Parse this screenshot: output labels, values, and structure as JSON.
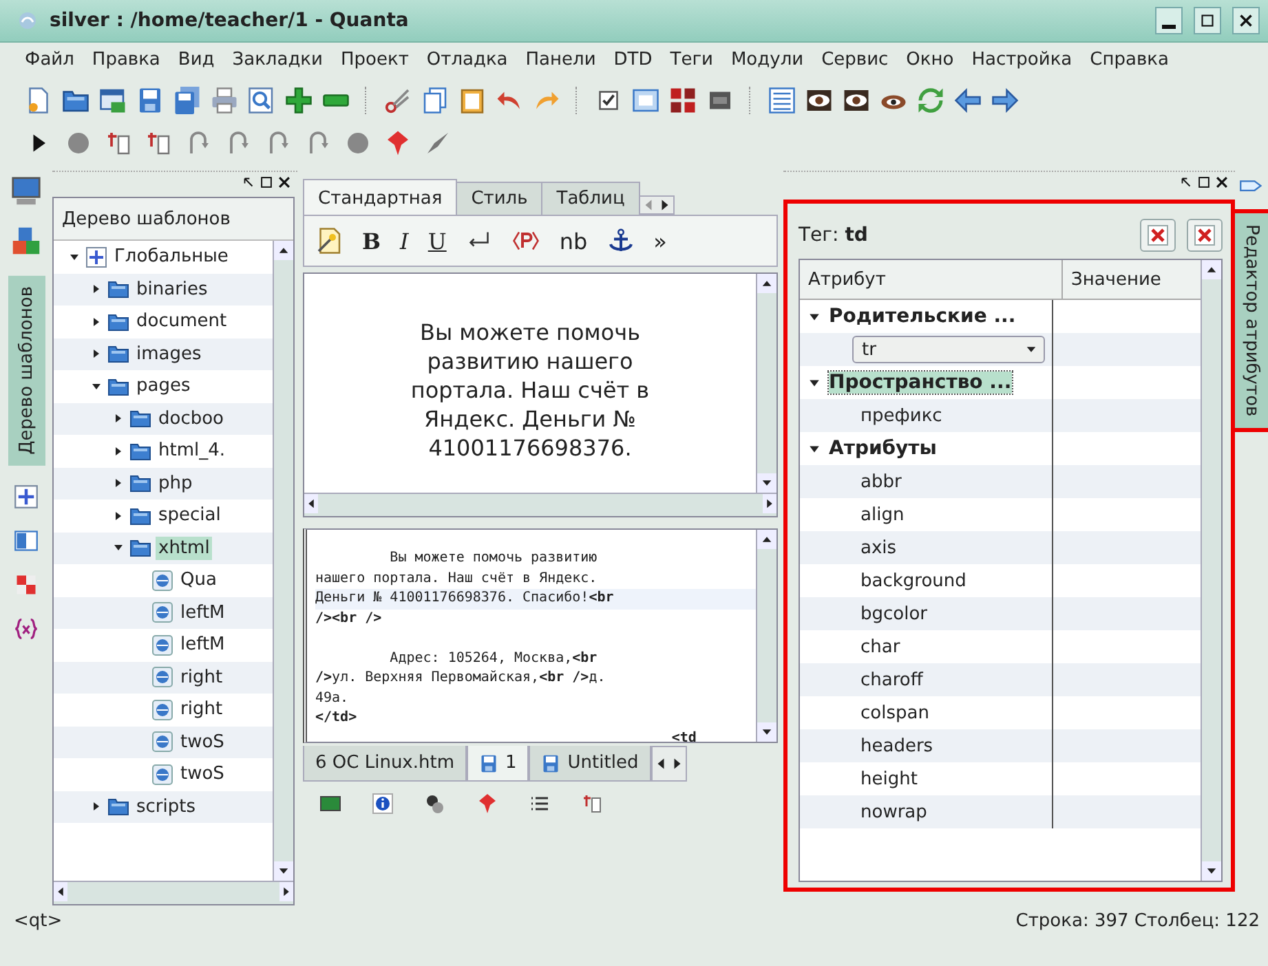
{
  "window": {
    "title": "silver : /home/teacher/1 - Quanta"
  },
  "menu": [
    {
      "label": "Файл"
    },
    {
      "label": "Правка"
    },
    {
      "label": "Вид"
    },
    {
      "label": "Закладки"
    },
    {
      "label": "Проект"
    },
    {
      "label": "Отладка"
    },
    {
      "label": "Панели"
    },
    {
      "label": "DTD"
    },
    {
      "label": "Теги"
    },
    {
      "label": "Модули"
    },
    {
      "label": "Сервис"
    },
    {
      "label": "Окно"
    },
    {
      "label": "Настройка"
    },
    {
      "label": "Справка"
    }
  ],
  "left_dock_tab": {
    "label": "Дерево шаблонов",
    "selected": true
  },
  "template_tree": {
    "title": "Дерево шаблонов",
    "items": [
      {
        "kind": "root",
        "label": "Глобальные",
        "expanded": true,
        "selected": false,
        "children": [
          {
            "kind": "folder",
            "label": "binaries",
            "expanded": false,
            "selected": false
          },
          {
            "kind": "folder",
            "label": "document",
            "expanded": false,
            "selected": false
          },
          {
            "kind": "folder",
            "label": "images",
            "expanded": false,
            "selected": false
          },
          {
            "kind": "folder",
            "label": "pages",
            "expanded": true,
            "selected": false,
            "children": [
              {
                "kind": "folder",
                "label": "docboo",
                "expanded": false,
                "selected": false
              },
              {
                "kind": "folder",
                "label": "html_4.",
                "expanded": false,
                "selected": false
              },
              {
                "kind": "folder",
                "label": "php",
                "expanded": false,
                "selected": false
              },
              {
                "kind": "folder",
                "label": "special",
                "expanded": false,
                "selected": false
              },
              {
                "kind": "folder",
                "label": "xhtml",
                "expanded": true,
                "selected": true,
                "children": [
                  {
                    "kind": "file",
                    "label": "Qua",
                    "selected": false
                  },
                  {
                    "kind": "file",
                    "label": "leftM",
                    "selected": false
                  },
                  {
                    "kind": "file",
                    "label": "leftM",
                    "selected": false
                  },
                  {
                    "kind": "file",
                    "label": "right",
                    "selected": false
                  },
                  {
                    "kind": "file",
                    "label": "right",
                    "selected": false
                  },
                  {
                    "kind": "file",
                    "label": "twoS",
                    "selected": false
                  },
                  {
                    "kind": "file",
                    "label": "twoS",
                    "selected": false
                  }
                ]
              }
            ]
          },
          {
            "kind": "folder",
            "label": "scripts",
            "expanded": false,
            "selected": false
          }
        ]
      }
    ]
  },
  "toolbox_tabs": [
    {
      "label": "Стандартная",
      "selected": true
    },
    {
      "label": "Стиль",
      "selected": false
    },
    {
      "label": "Таблиц",
      "selected": false
    }
  ],
  "quick_tags": [
    {
      "kind": "icon"
    },
    {
      "kind": "bold",
      "text": "B"
    },
    {
      "kind": "italic",
      "text": "I"
    },
    {
      "kind": "underline",
      "text": "U"
    },
    {
      "kind": "icon"
    },
    {
      "kind": "icon"
    },
    {
      "kind": "plain",
      "text": "nb"
    },
    {
      "kind": "icon"
    },
    {
      "kind": "plain",
      "text": "»"
    }
  ],
  "preview": {
    "text": "Вы можете помочь развитию нашего портала. Наш счёт в Яндекс. Деньги № 41001176698376."
  },
  "source_lines": [
    {
      "kind": "code",
      "text": "         Вы можете помочь развитию",
      "current": false
    },
    {
      "kind": "code",
      "text": "нашего портала. Наш счёт в Яндекс.",
      "current": false
    },
    {
      "kind": "code",
      "text": "Деньги № 41001176698376. Спасибо!**<br**",
      "current": true
    },
    {
      "kind": "code",
      "text": "**/><br />**",
      "current": false
    },
    {
      "kind": "blank"
    },
    {
      "kind": "code",
      "text": "         Адрес: 105264, Москва,**<br**",
      "current": false
    },
    {
      "kind": "code",
      "text": "**/>**ул. Верхняя Первомайская,**<br />**д.",
      "current": false
    },
    {
      "kind": "code",
      "text": "49а.",
      "current": false
    },
    {
      "kind": "code",
      "text": "**</td>**",
      "current": false
    },
    {
      "kind": "code",
      "text": "                                           **<td**",
      "current": false
    }
  ],
  "document_tabs": [
    {
      "label": "6 ОС Linux.htm",
      "selected": false,
      "saved_icon": false
    },
    {
      "label": "1",
      "selected": true,
      "saved_icon": true
    },
    {
      "label": "Untitled",
      "selected": false,
      "saved_icon": true
    }
  ],
  "attribute_editor": {
    "tag_label": "Тег: **td**",
    "columns": [
      "Атрибут",
      "Значение"
    ],
    "rows": [
      {
        "kind": "group",
        "label": "Родительские ...",
        "expanded": true,
        "selected": false,
        "children": [
          {
            "kind": "combo",
            "label": "tr"
          }
        ]
      },
      {
        "kind": "group",
        "label": "Пространство ...",
        "expanded": true,
        "selected": true,
        "children": [
          {
            "kind": "attr",
            "label": "префикс"
          }
        ]
      },
      {
        "kind": "group",
        "label": "Атрибуты",
        "expanded": true,
        "selected": false,
        "children": [
          {
            "kind": "attr",
            "label": "abbr"
          },
          {
            "kind": "attr",
            "label": "align"
          },
          {
            "kind": "attr",
            "label": "axis"
          },
          {
            "kind": "attr",
            "label": "background"
          },
          {
            "kind": "attr",
            "label": "bgcolor"
          },
          {
            "kind": "attr",
            "label": "char"
          },
          {
            "kind": "attr",
            "label": "charoff"
          },
          {
            "kind": "attr",
            "label": "colspan"
          },
          {
            "kind": "attr",
            "label": "headers"
          },
          {
            "kind": "attr",
            "label": "height"
          },
          {
            "kind": "attr",
            "label": "nowrap"
          }
        ]
      }
    ]
  },
  "right_dock_tab": {
    "label": "Редактор атрибутов",
    "selected": true
  },
  "status_bar": {
    "left": "<qt>",
    "right": "Строка: 397 Столбец: 122"
  }
}
